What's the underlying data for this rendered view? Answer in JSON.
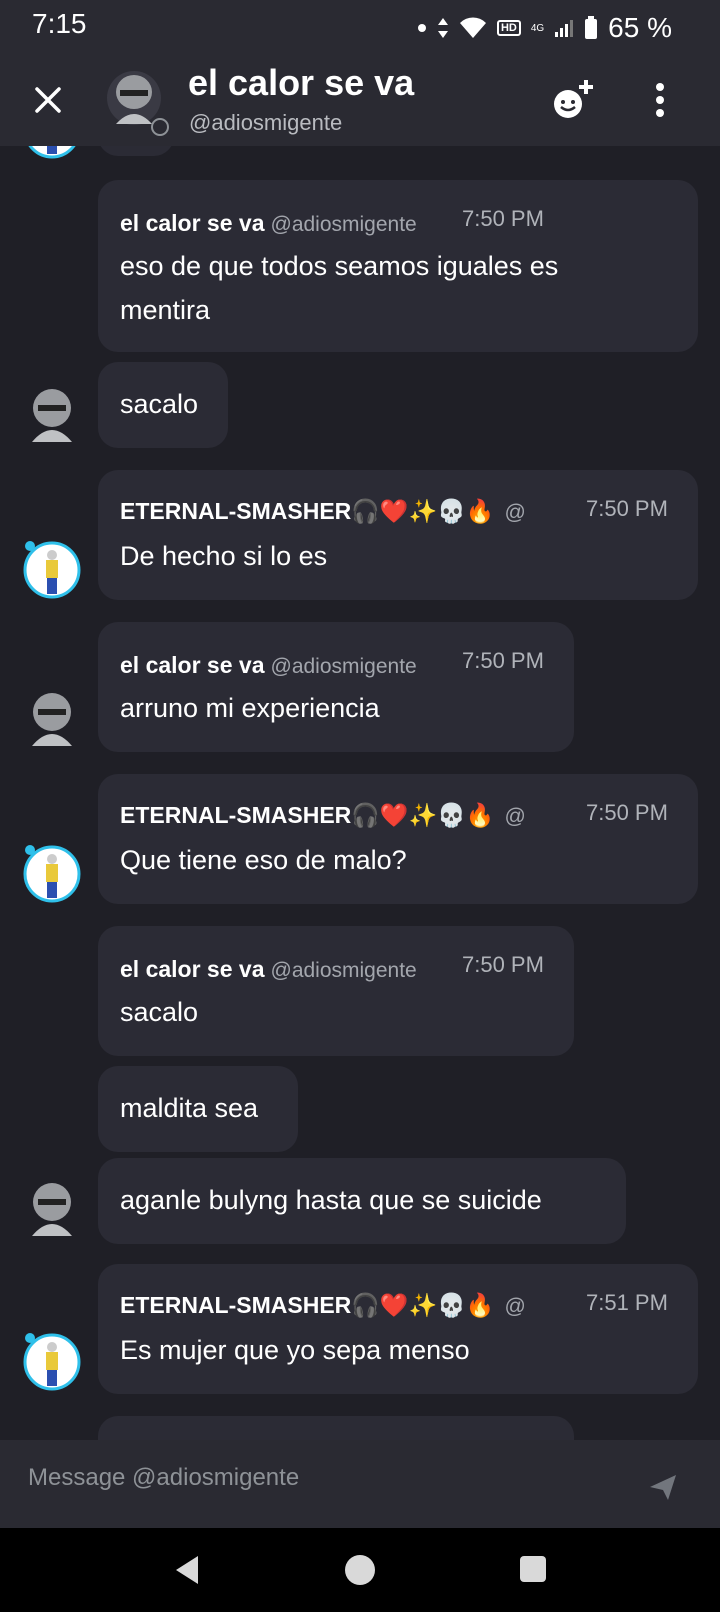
{
  "status_bar": {
    "time": "7:15",
    "network": "4G",
    "hd": "HD",
    "battery": "65 %"
  },
  "header": {
    "title": "el calor se va",
    "handle": "@adiosmigente",
    "close_icon": "close-icon",
    "add_friend_icon": "add-friend-icon",
    "more_icon": "more-vertical-icon"
  },
  "messages": [
    {
      "author": "el calor se va",
      "handle": "@adiosmigente",
      "time": "7:50 PM",
      "lines": [
        "eso de que todos seamos iguales es",
        "mentira"
      ]
    },
    {
      "text": "sacalo"
    },
    {
      "author": "ETERNAL-SMASHER🎧❤️✨💀🔥",
      "handle": "@",
      "time": "7:50 PM",
      "lines": [
        "De hecho si lo es"
      ]
    },
    {
      "author": "el calor se va",
      "handle": "@adiosmigente",
      "time": "7:50 PM",
      "lines": [
        "arruno mi experiencia"
      ]
    },
    {
      "author": "ETERNAL-SMASHER🎧❤️✨💀🔥",
      "handle": "@",
      "time": "7:50 PM",
      "lines": [
        "Que tiene eso de malo?"
      ]
    },
    {
      "author": "el calor se va",
      "handle": "@adiosmigente",
      "time": "7:50 PM",
      "lines": [
        "sacalo"
      ]
    },
    {
      "text": "maldita sea"
    },
    {
      "text": "aganle bulyng hasta que se suicide"
    },
    {
      "author": "ETERNAL-SMASHER🎧❤️✨💀🔥",
      "handle": "@",
      "time": "7:51 PM",
      "lines": [
        "Es mujer que yo sepa menso"
      ]
    }
  ],
  "composer": {
    "placeholder": "Message @adiosmigente",
    "send_icon": "send-icon"
  },
  "nav": {
    "back_icon": "back-icon",
    "home_icon": "home-icon",
    "recents_icon": "recents-icon"
  },
  "colors": {
    "background": "#1f1f26",
    "bubble": "#2b2b35",
    "header": "#2a2a32",
    "avatar_ring": "#2fc0ea"
  }
}
